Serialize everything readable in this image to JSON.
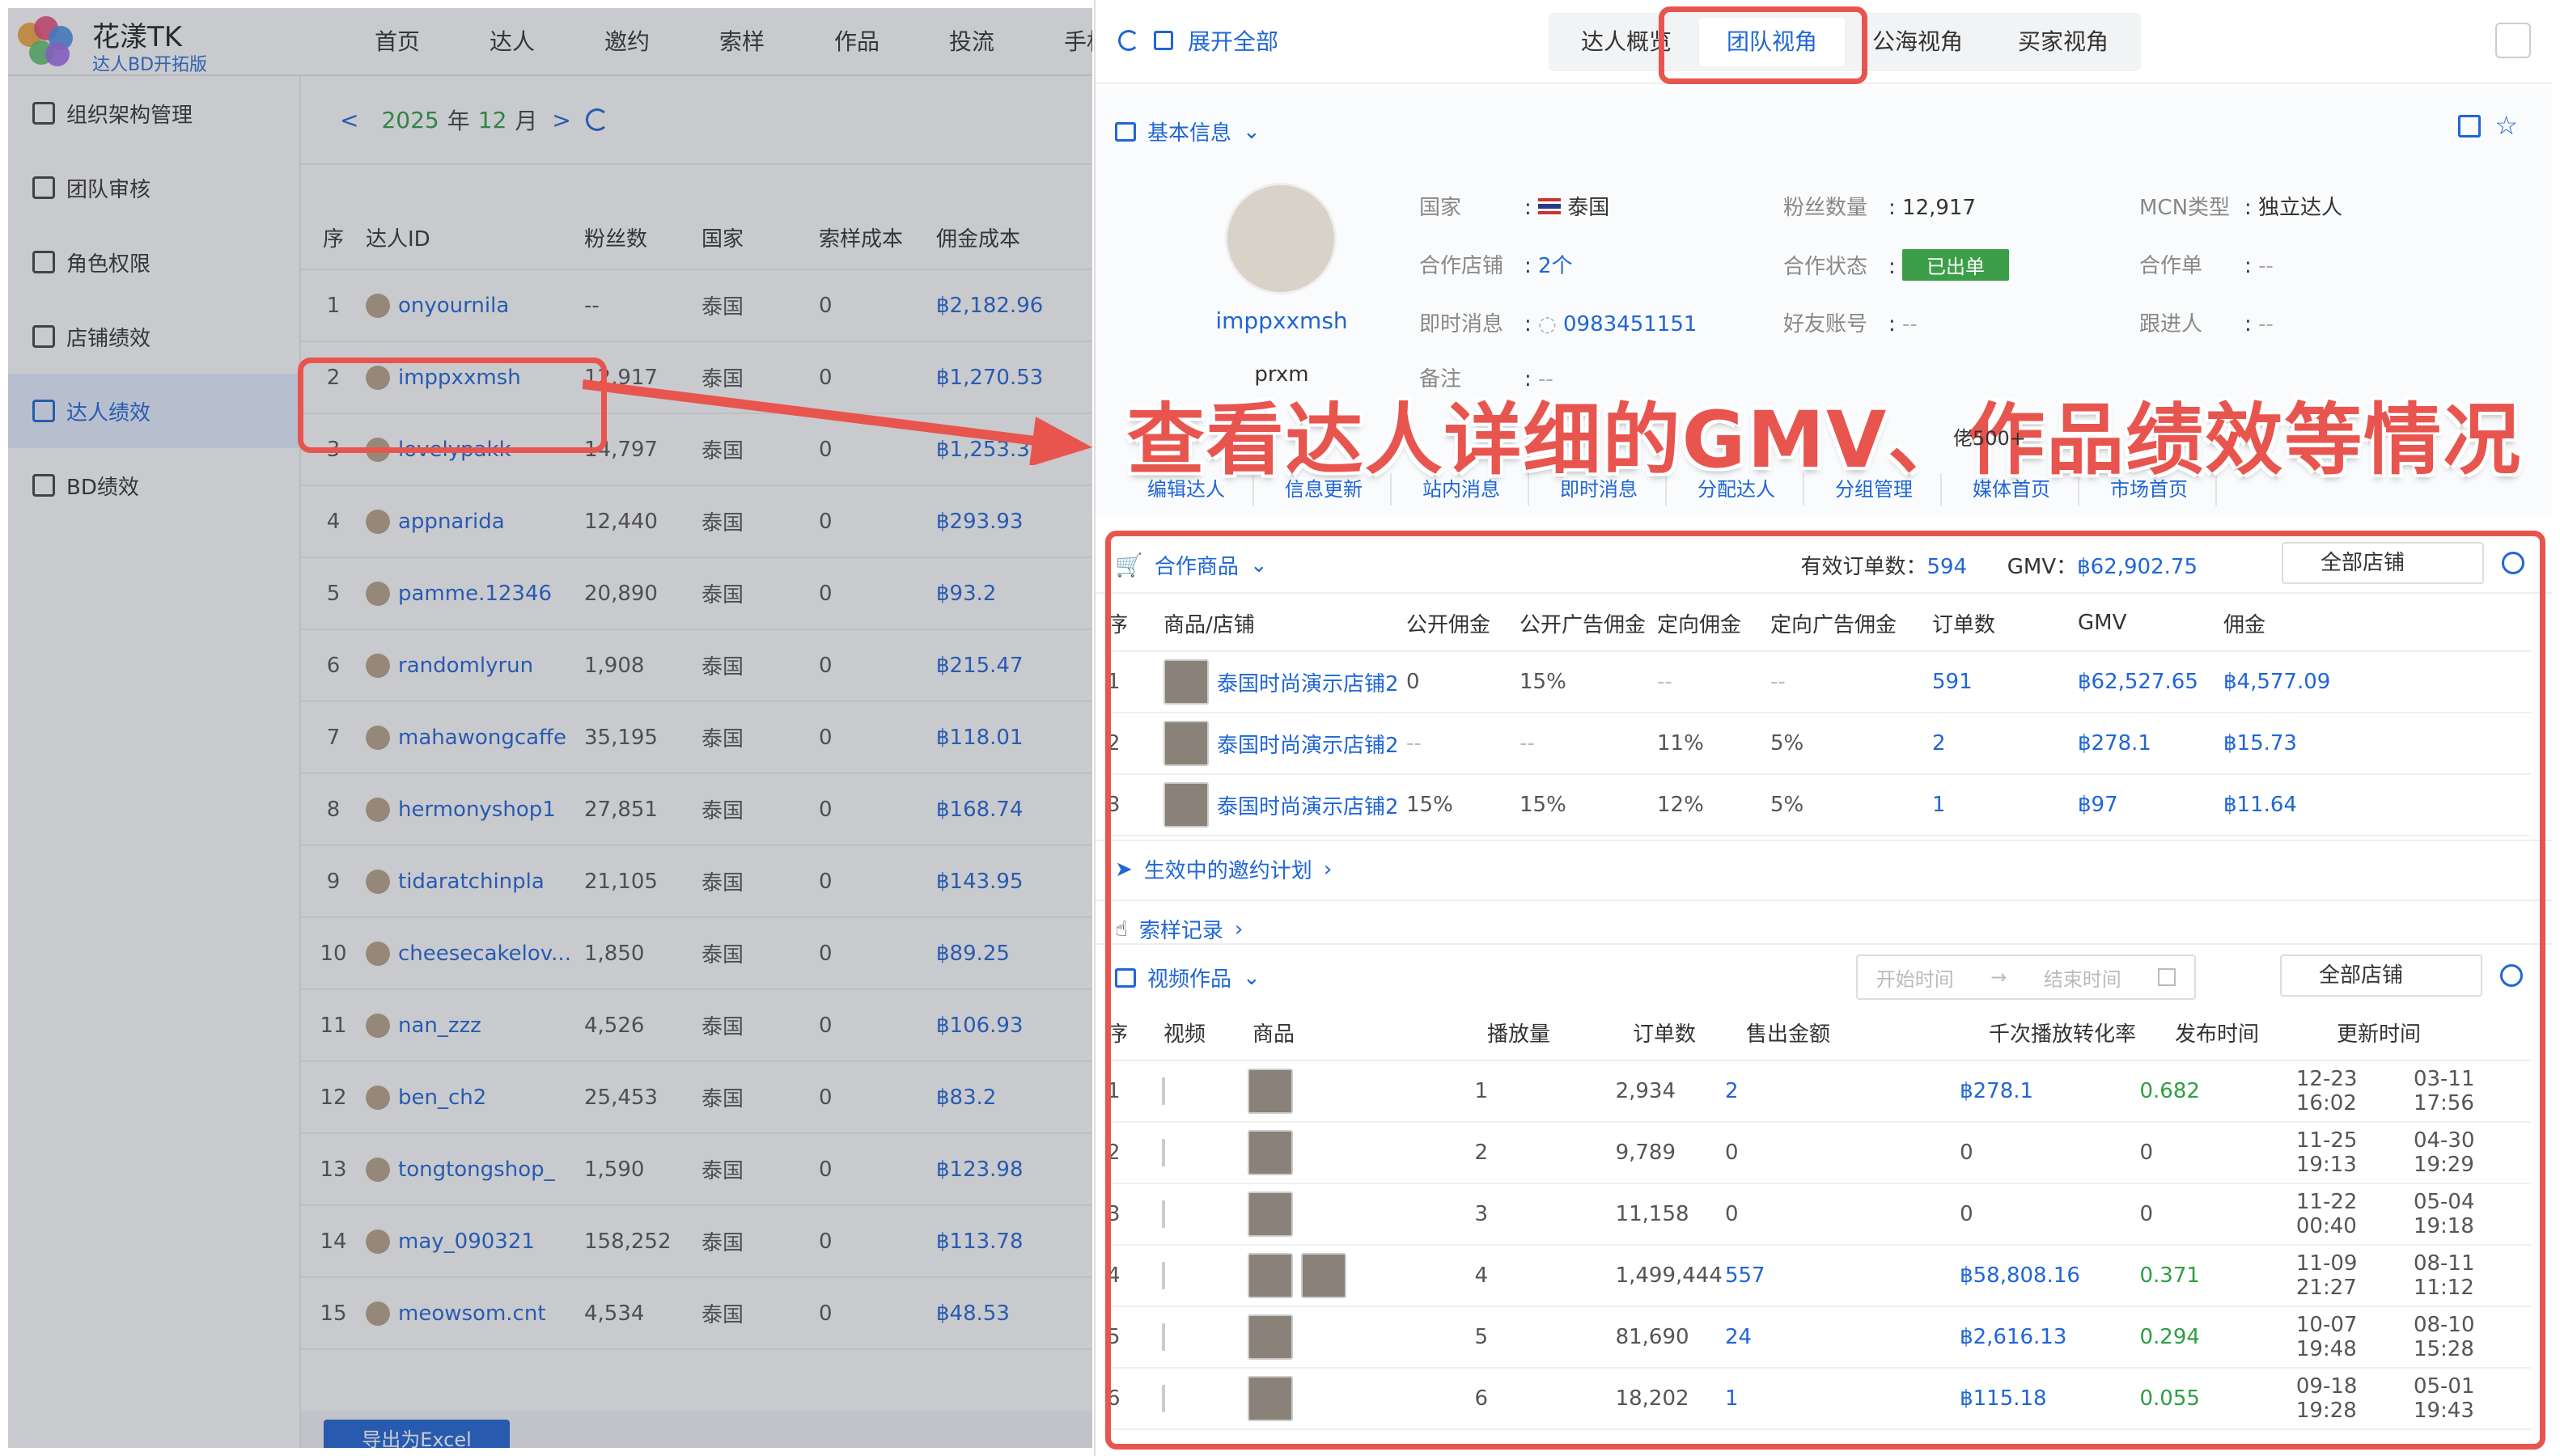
{
  "app": {
    "brand": "花漾TK",
    "brand_sub": "达人BD开拓版"
  },
  "topnav": [
    "首页",
    "达人",
    "邀约",
    "索样",
    "作品",
    "投流",
    "手机"
  ],
  "sidebar": [
    {
      "label": "组织架构管理",
      "icon": "org-chart-icon",
      "active": false
    },
    {
      "label": "团队审核",
      "icon": "user-check-icon",
      "active": false
    },
    {
      "label": "角色权限",
      "icon": "user-key-icon",
      "active": false
    },
    {
      "label": "店铺绩效",
      "icon": "store-icon",
      "active": false
    },
    {
      "label": "达人绩效",
      "icon": "creator-icon",
      "active": true
    },
    {
      "label": "BD绩效",
      "icon": "bar-chart-icon",
      "active": false
    }
  ],
  "datebar": {
    "prev": "<",
    "year": "2025",
    "year_unit": "年",
    "month": "12",
    "month_unit": "月",
    "next": ">"
  },
  "left_table": {
    "headers": [
      "序",
      "达人ID",
      "粉丝数",
      "国家",
      "索样成本",
      "佣金成本"
    ],
    "rows": [
      [
        "1",
        "onyournila",
        "--",
        "泰国",
        "0",
        "฿2,182.96"
      ],
      [
        "2",
        "imppxxmsh",
        "12,917",
        "泰国",
        "0",
        "฿1,270.53"
      ],
      [
        "3",
        "lovelypakk",
        "14,797",
        "泰国",
        "0",
        "฿1,253.38"
      ],
      [
        "4",
        "appnarida",
        "12,440",
        "泰国",
        "0",
        "฿293.93"
      ],
      [
        "5",
        "pamme.12346",
        "20,890",
        "泰国",
        "0",
        "฿93.2"
      ],
      [
        "6",
        "randomlyrun",
        "1,908",
        "泰国",
        "0",
        "฿215.47"
      ],
      [
        "7",
        "mahawongcaffe",
        "35,195",
        "泰国",
        "0",
        "฿118.01"
      ],
      [
        "8",
        "hermonyshop1",
        "27,851",
        "泰国",
        "0",
        "฿168.74"
      ],
      [
        "9",
        "tidaratchinpla",
        "21,105",
        "泰国",
        "0",
        "฿143.95"
      ],
      [
        "10",
        "cheesecakelov...",
        "1,850",
        "泰国",
        "0",
        "฿89.25"
      ],
      [
        "11",
        "nan_zzz",
        "4,526",
        "泰国",
        "0",
        "฿106.93"
      ],
      [
        "12",
        "ben_ch2",
        "25,453",
        "泰国",
        "0",
        "฿83.2"
      ],
      [
        "13",
        "tongtongshop_",
        "1,590",
        "泰国",
        "0",
        "฿123.98"
      ],
      [
        "14",
        "may_090321",
        "158,252",
        "泰国",
        "0",
        "฿113.78"
      ],
      [
        "15",
        "meowsom.cnt",
        "4,534",
        "泰国",
        "0",
        "฿48.53"
      ]
    ],
    "export_label": "导出为Excel"
  },
  "drawer": {
    "expand_label": "展开全部",
    "tabs": [
      "达人概览",
      "团队视角",
      "公海视角",
      "买家视角"
    ],
    "active_tab": 1,
    "basic_title": "基本信息",
    "profile": {
      "name": "imppxxmsh",
      "sub": "prxm"
    },
    "info": {
      "country_k": "国家",
      "country_v": "泰国",
      "fans_k": "粉丝数量",
      "fans_v": "12,917",
      "mcn_k": "MCN类型",
      "mcn_v": "独立达人",
      "shop_k": "合作店铺",
      "shop_v": "2个",
      "status_k": "合作状态",
      "status_v": "已出单",
      "coop_k": "合作单",
      "coop_v": "--",
      "im_k": "即时消息",
      "im_v": "0983451151",
      "friend_k": "好友账号",
      "friend_v": "--",
      "follow_k": "跟进人",
      "follow_v": "--",
      "note_k": "备注",
      "note_v": "--",
      "sep": ":"
    },
    "banner": "查看达人详细的GMV、作品绩效等情况",
    "banner_tail": "佬500+",
    "actions": [
      "编辑达人",
      "信息更新",
      "站内消息",
      "即时消息",
      "分配达人",
      "分组管理",
      "媒体首页",
      "市场首页"
    ],
    "goods": {
      "title": "合作商品",
      "orders_k": "有效订单数：",
      "orders_v": "594",
      "gmv_k": "GMV：",
      "gmv_v": "฿62,902.75",
      "store_select": "全部店铺",
      "headers": [
        "序",
        "商品/店铺",
        "公开佣金",
        "公开广告佣金",
        "定向佣金",
        "定向广告佣金",
        "订单数",
        "GMV",
        "佣金"
      ],
      "rows": [
        [
          "1",
          "泰国时尚演示店铺2",
          "0",
          "15%",
          "--",
          "--",
          "591",
          "฿62,527.65",
          "฿4,577.09"
        ],
        [
          "2",
          "泰国时尚演示店铺2",
          "--",
          "--",
          "11%",
          "5%",
          "2",
          "฿278.1",
          "฿15.73"
        ],
        [
          "3",
          "泰国时尚演示店铺2",
          "15%",
          "15%",
          "12%",
          "5%",
          "1",
          "฿97",
          "฿11.64"
        ]
      ]
    },
    "invite_plan": "生效中的邀约计划",
    "sample_record": "索样记录",
    "videos": {
      "title": "视频作品",
      "start_ph": "开始时间",
      "end_ph": "结束时间",
      "arrow": "→",
      "store_select": "全部店铺",
      "headers": [
        "序",
        "视频",
        "商品",
        "播放量",
        "订单数",
        "售出金额",
        "千次播放转化率",
        "发布时间",
        "更新时间"
      ],
      "rows": [
        [
          "1",
          "2,934",
          "2",
          "฿278.1",
          "0.682",
          "12-23 16:02",
          "03-11 17:56"
        ],
        [
          "2",
          "9,789",
          "0",
          "0",
          "0",
          "11-25 19:13",
          "04-30 19:29"
        ],
        [
          "3",
          "11,158",
          "0",
          "0",
          "0",
          "11-22 00:40",
          "05-04 19:18"
        ],
        [
          "4",
          "1,499,444",
          "557",
          "฿58,808.16",
          "0.371",
          "11-09 21:27",
          "08-11 11:12"
        ],
        [
          "5",
          "81,690",
          "24",
          "฿2,616.13",
          "0.294",
          "10-07 19:48",
          "08-10 15:28"
        ],
        [
          "6",
          "18,202",
          "1",
          "฿115.18",
          "0.055",
          "09-18 19:28",
          "05-01 19:43"
        ]
      ]
    }
  },
  "colors": {
    "accent": "#2066d6",
    "highlight": "#e8554e",
    "success": "#3d9e49"
  }
}
